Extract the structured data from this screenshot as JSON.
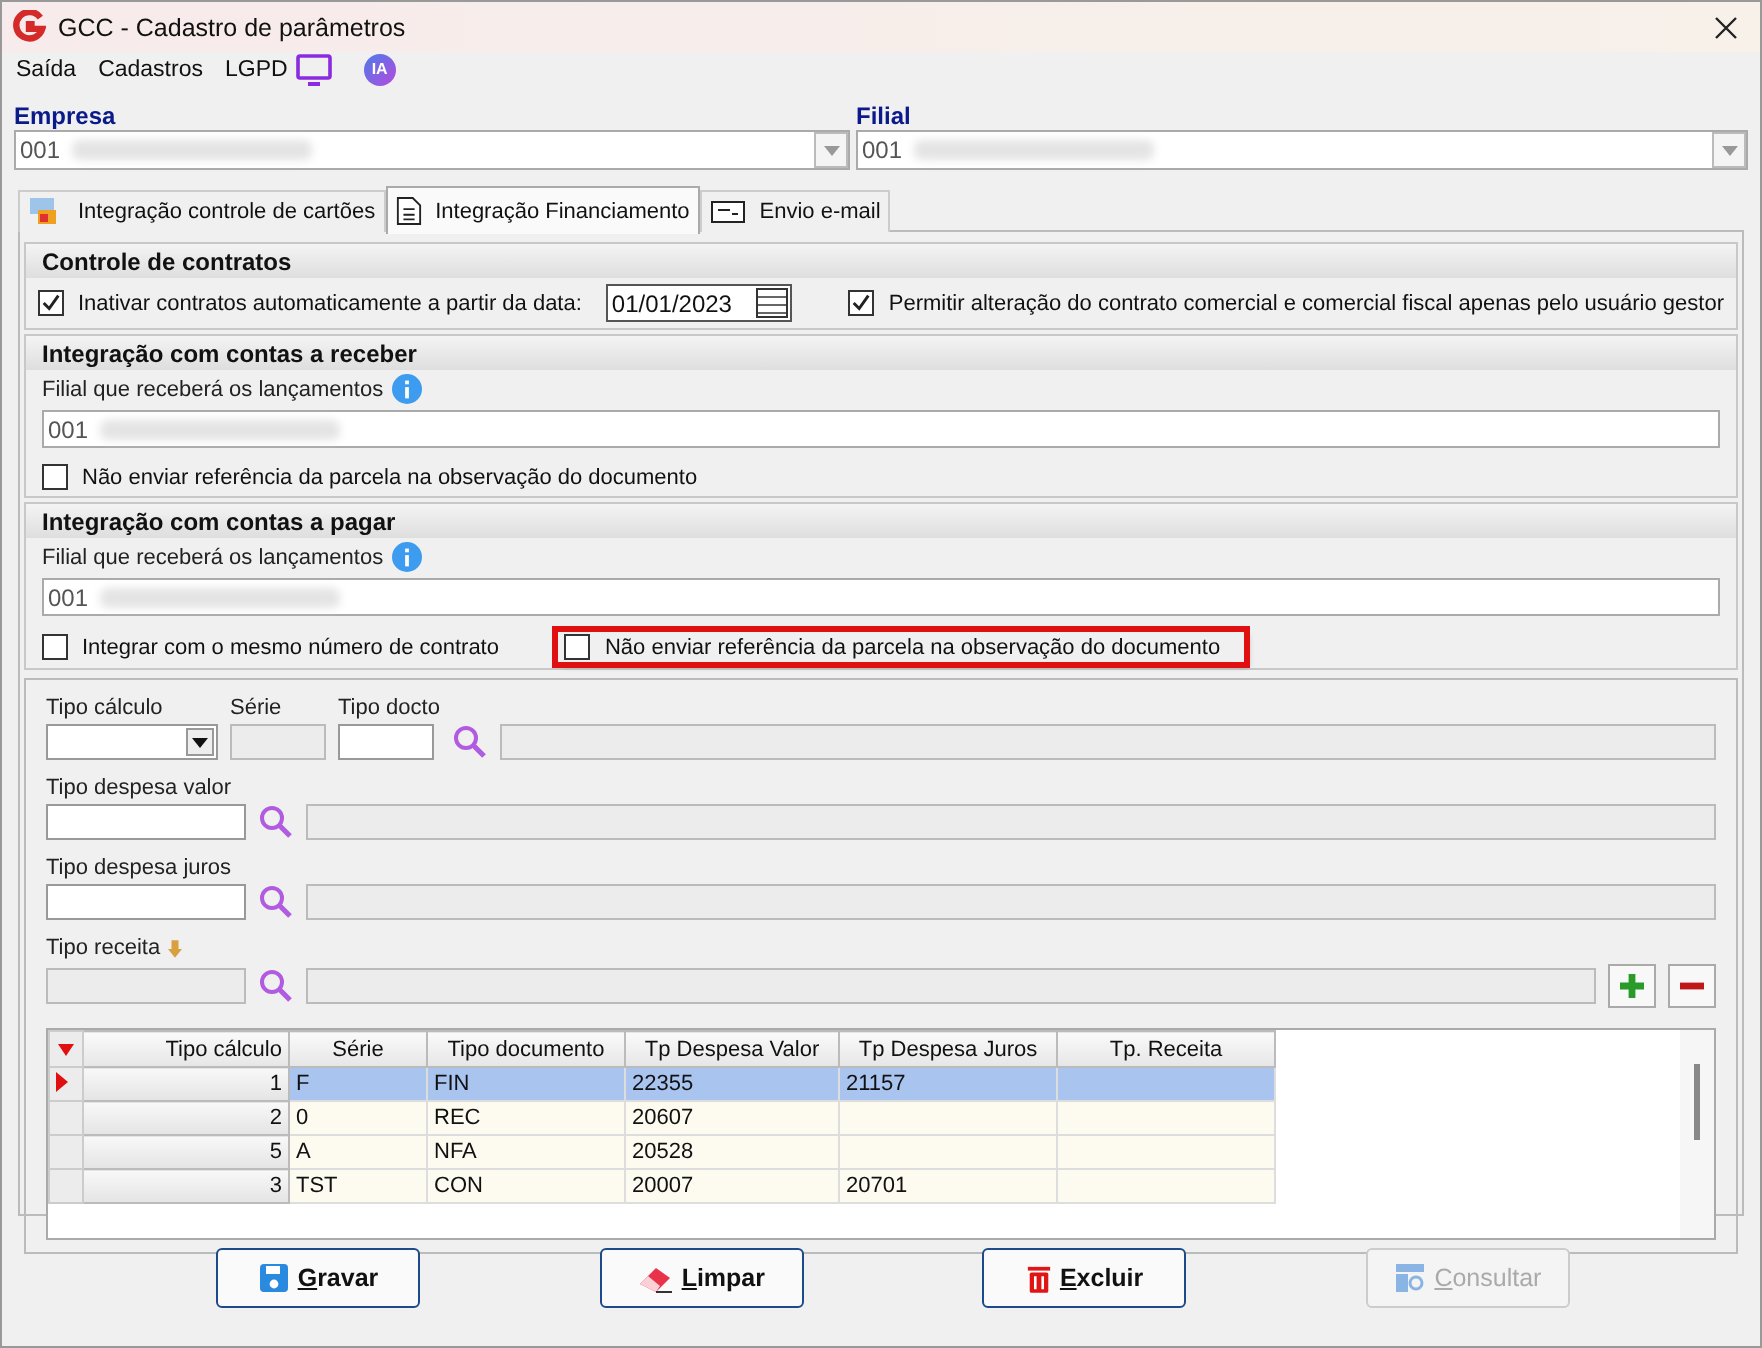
{
  "window": {
    "title": "GCC - Cadastro de parâmetros"
  },
  "menu": [
    {
      "label": "Saída",
      "kind": "text"
    },
    {
      "label": "Cadastros",
      "kind": "text"
    },
    {
      "label": "LGPD",
      "kind": "text"
    },
    {
      "kind": "monitor"
    },
    {
      "label": "IA",
      "kind": "badge"
    }
  ],
  "empresa": {
    "label": "Empresa",
    "value": "001"
  },
  "filial": {
    "label": "Filial",
    "value": "001"
  },
  "tabs": [
    {
      "label": "Integração controle de cartões",
      "kind": "card",
      "selected": false
    },
    {
      "label": "Integração Financiamento",
      "kind": "doc",
      "selected": true
    },
    {
      "label": "Envio e-mail",
      "kind": "mail",
      "selected": false
    }
  ],
  "controle_contratos": {
    "title": "Controle de contratos",
    "inactivate": {
      "label": "Inativar contratos automaticamente a partir da data:",
      "checked": true
    },
    "date": "01/01/2023",
    "permit": {
      "label": "Permitir alteração do contrato comercial e comercial fiscal apenas pelo usuário gestor",
      "checked": true
    }
  },
  "contas_receber": {
    "title": "Integração com contas a receber",
    "field_label": "Filial que receberá os lançamentos",
    "field_value": "001",
    "checkboxes": [
      {
        "label": "Não enviar referência da parcela na observação do documento",
        "checked": false,
        "highlighted": false
      }
    ]
  },
  "contas_pagar": {
    "title": "Integração com contas a pagar",
    "field_label": "Filial que receberá os lançamentos",
    "field_value": "001",
    "checkboxes": [
      {
        "label": "Integrar com o mesmo número de contrato",
        "checked": false,
        "highlighted": false
      },
      {
        "label": "Não enviar referência da parcela na observação do documento",
        "checked": false,
        "highlighted": true
      }
    ]
  },
  "form": {
    "tipo_calculo": "Tipo cálculo",
    "serie": "Série",
    "tipo_docto": "Tipo docto",
    "tipo_despesa_valor": "Tipo despesa valor",
    "tipo_despesa_juros": "Tipo despesa juros",
    "tipo_receita": "Tipo receita"
  },
  "table": {
    "columns": [
      "Tipo cálculo",
      "Série",
      "Tipo documento",
      "Tp Despesa Valor",
      "Tp Despesa Juros",
      "Tp. Receita"
    ],
    "rows": [
      {
        "cells": [
          "1",
          "F",
          "FIN",
          "22355",
          "21157",
          ""
        ],
        "selected": true
      },
      {
        "cells": [
          "2",
          "0",
          "REC",
          "20607",
          "",
          ""
        ],
        "selected": false
      },
      {
        "cells": [
          "5",
          "A",
          "NFA",
          "20528",
          "",
          ""
        ],
        "selected": false
      },
      {
        "cells": [
          "3",
          "TST",
          "CON",
          "20007",
          "20701",
          ""
        ],
        "selected": false
      }
    ]
  },
  "buttons": [
    {
      "label": "Gravar",
      "kind": "save",
      "disabled": false
    },
    {
      "label": "Limpar",
      "kind": "eraser",
      "disabled": false
    },
    {
      "label": "Excluir",
      "kind": "trash",
      "disabled": false
    },
    {
      "label": "Consultar",
      "kind": "grid",
      "disabled": true
    }
  ]
}
